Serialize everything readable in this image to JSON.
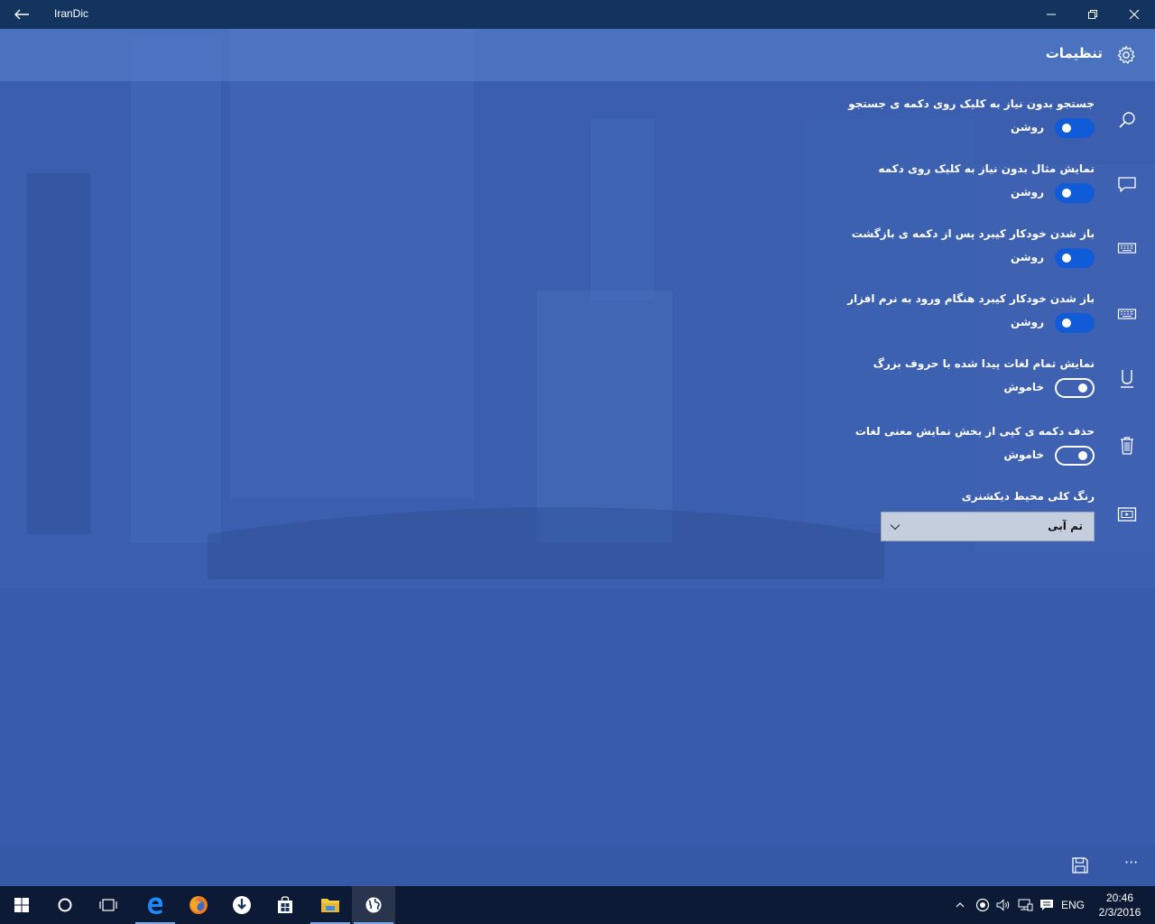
{
  "window": {
    "title": "IranDic"
  },
  "header": {
    "title": "تنظیمات"
  },
  "settings": [
    {
      "label": "جستجو بدون نیاز به کلیک روی دکمه ی جستجو",
      "state": "روشن",
      "on": true
    },
    {
      "label": "نمایش مثال بدون نیاز به کلیک روی دکمه",
      "state": "روشن",
      "on": true
    },
    {
      "label": "باز شدن خودکار کیبرد پس از دکمه ی بازگشت",
      "state": "روشن",
      "on": true
    },
    {
      "label": "باز شدن خودکار کیبرد هنگام ورود به نرم افزار",
      "state": "روشن",
      "on": true
    },
    {
      "label": "نمایش تمام لغات پیدا شده با حروف بزرگ",
      "state": "خاموش",
      "on": false
    },
    {
      "label": "حذف دکمه ی کپی از بخش نمایش معنی لغات",
      "state": "خاموش",
      "on": false
    }
  ],
  "theme": {
    "label": "رنگ کلی محیط دیکشنری",
    "selected": "تم آبی"
  },
  "rail_icons": [
    "search-icon",
    "comment-icon",
    "keyboard-icon",
    "keyboard-icon",
    "underline-icon",
    "trash-icon",
    "slideshow-icon"
  ],
  "commandbar": {
    "more": "···"
  },
  "taskbar": {
    "language": "ENG",
    "time": "20:46",
    "date": "2/3/2016"
  },
  "colors": {
    "titlebar": "#13345f",
    "background": "#3a5eac",
    "toggle_on": "#0f5bd8",
    "taskbar": "#0c1a35"
  }
}
